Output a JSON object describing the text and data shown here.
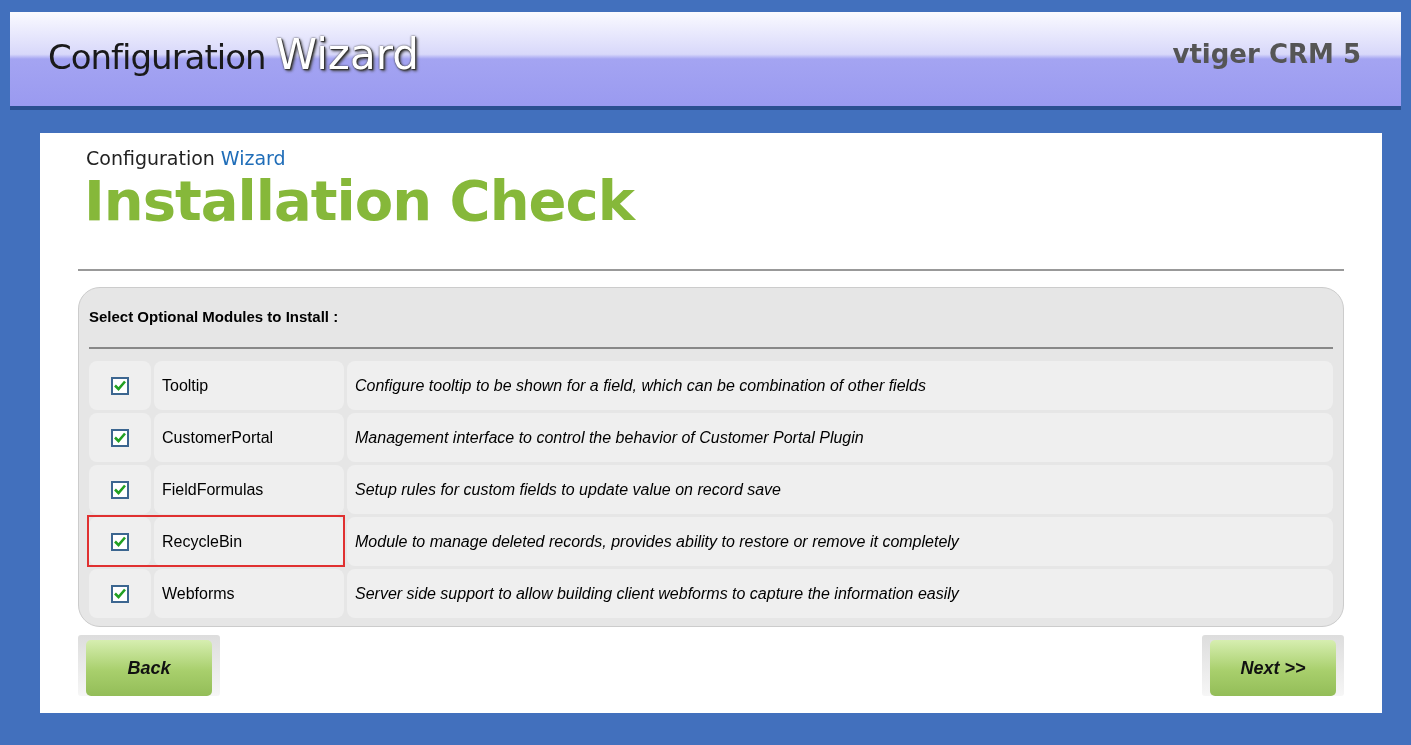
{
  "header": {
    "title_dark": "Configuration",
    "title_light": "Wizard",
    "product": "vtiger CRM 5"
  },
  "page": {
    "subtitle_dark": "Configuration",
    "subtitle_blue": "Wizard",
    "title": "Installation Check"
  },
  "panel": {
    "heading": "Select Optional Modules to Install :",
    "modules": [
      {
        "name": "Tooltip",
        "description": "Configure tooltip to be shown for a field, which can be combination of other fields",
        "checked": true,
        "highlighted": false
      },
      {
        "name": "CustomerPortal",
        "description": "Management interface to control the behavior of Customer Portal Plugin",
        "checked": true,
        "highlighted": false
      },
      {
        "name": "FieldFormulas",
        "description": "Setup rules for custom fields to update value on record save",
        "checked": true,
        "highlighted": false
      },
      {
        "name": "RecycleBin",
        "description": "Module to manage deleted records, provides ability to restore or remove it completely",
        "checked": true,
        "highlighted": true
      },
      {
        "name": "Webforms",
        "description": "Server side support to allow building client webforms to capture the information easily",
        "checked": true,
        "highlighted": false
      }
    ]
  },
  "buttons": {
    "back": "Back",
    "next": "Next >>"
  }
}
